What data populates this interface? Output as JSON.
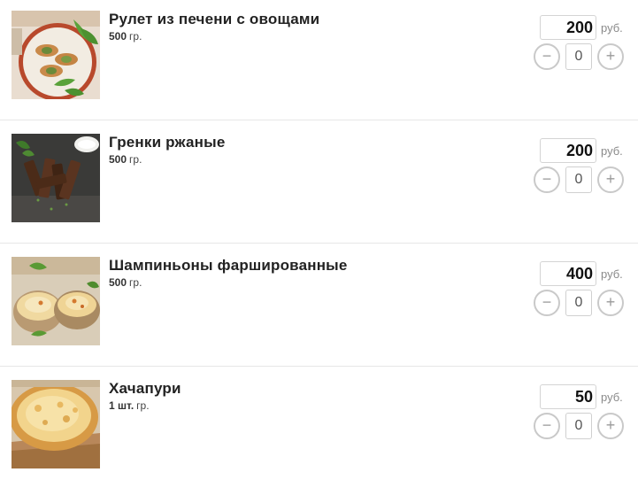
{
  "currency_label": "руб.",
  "items": [
    {
      "title": "Рулет из печени с овощами",
      "weight_value": "500",
      "weight_unit": "гр.",
      "price": "200",
      "qty": "0",
      "minus_label": "−",
      "plus_label": "+"
    },
    {
      "title": "Гренки ржаные",
      "weight_value": "500",
      "weight_unit": "гр.",
      "price": "200",
      "qty": "0",
      "minus_label": "−",
      "plus_label": "+"
    },
    {
      "title": "Шампиньоны фаршированные",
      "weight_value": "500",
      "weight_unit": "гр.",
      "price": "400",
      "qty": "0",
      "minus_label": "−",
      "plus_label": "+"
    },
    {
      "title": "Хачапури",
      "weight_value": "1 шт.",
      "weight_unit": "гр.",
      "price": "50",
      "qty": "0",
      "minus_label": "−",
      "plus_label": "+"
    }
  ]
}
